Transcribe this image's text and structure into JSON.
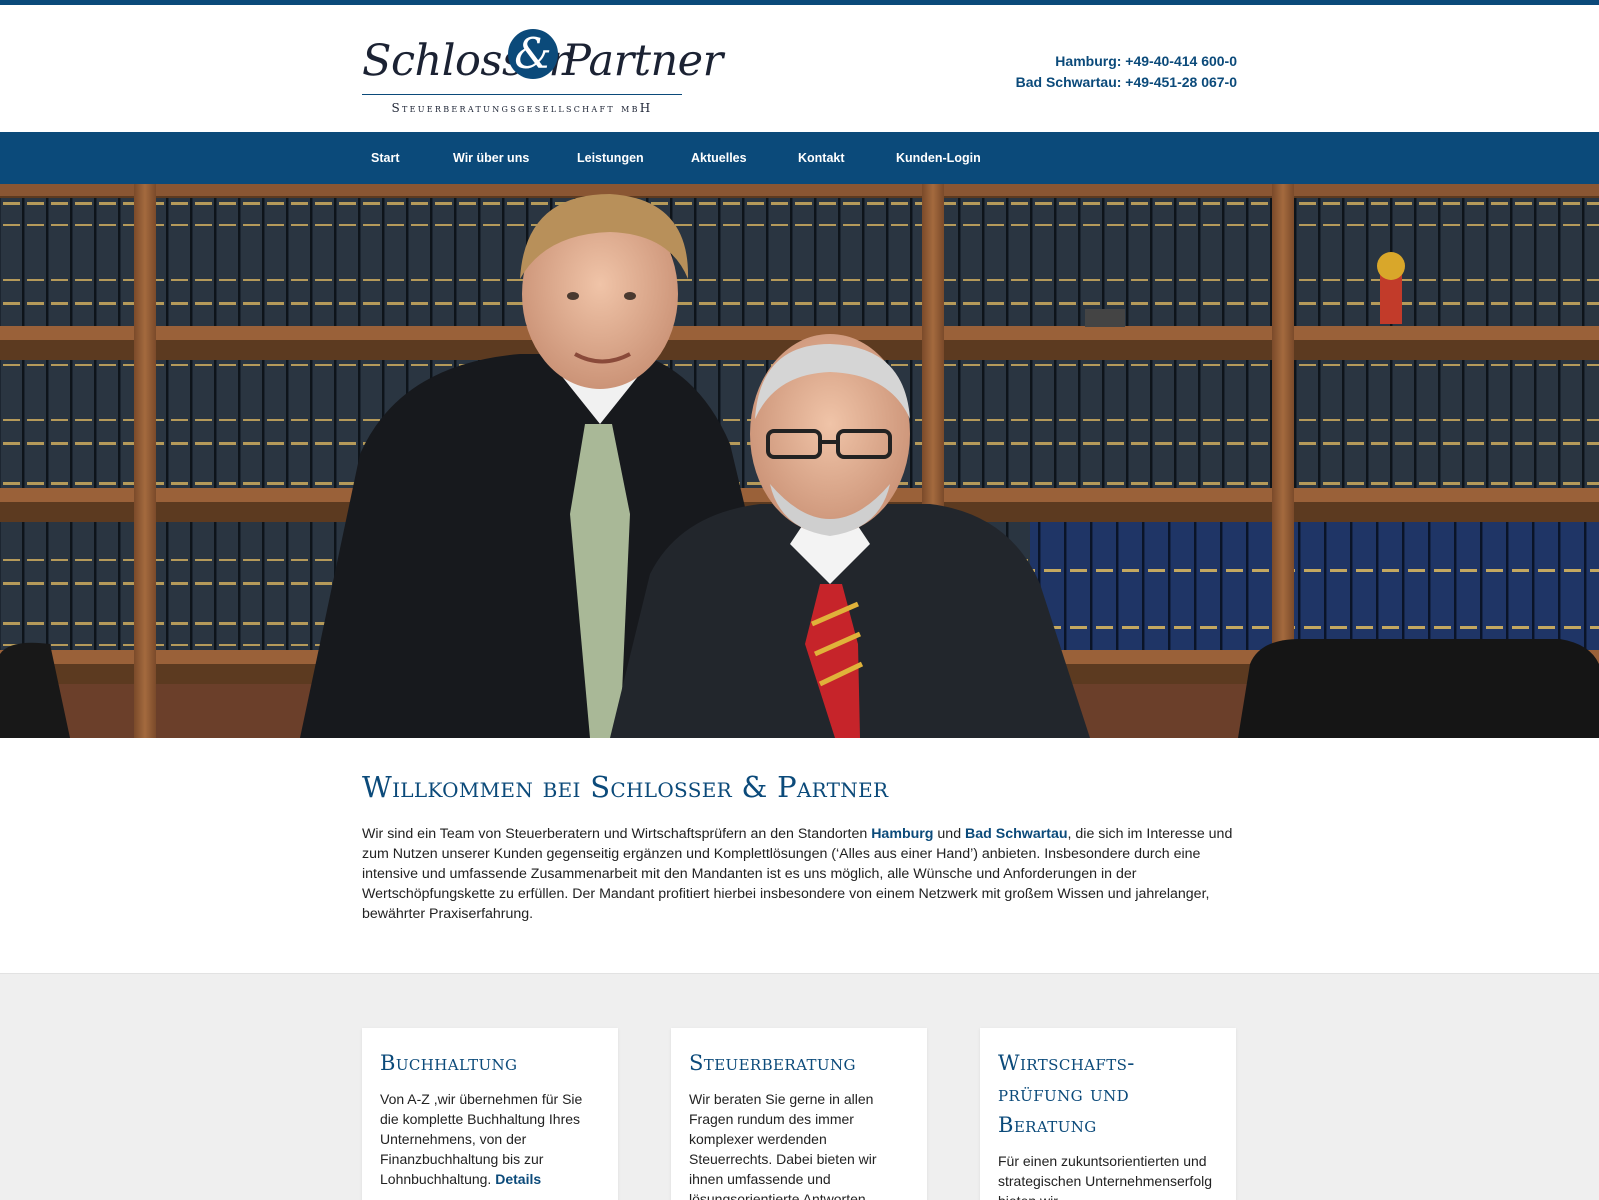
{
  "logo": {
    "name_left": "Schlosser",
    "ampersand": "&",
    "name_right": "Partner",
    "subtitle": "Steuerberatungsgesellschaft mbH"
  },
  "contact": {
    "hamburg": "Hamburg: +49-40-414 600-0",
    "bad_schwartau": "Bad Schwartau: +49-451-28 067-0"
  },
  "nav": {
    "items": [
      {
        "label": "Start"
      },
      {
        "label": "Wir über uns"
      },
      {
        "label": "Leistungen"
      },
      {
        "label": "Aktuelles"
      },
      {
        "label": "Kontakt"
      },
      {
        "label": "Kunden-Login"
      }
    ]
  },
  "colors": {
    "brand_blue": "#0b4a7a",
    "services_bg": "#efefef"
  },
  "welcome": {
    "title": "Willkommen bei Schlosser & Partner",
    "text_1": "Wir sind ein Team von Steuerberatern und Wirtschaftsprüfern an den Standorten ",
    "link_hamburg": "Hamburg",
    "text_2": " und ",
    "link_bad_schwartau": "Bad Schwartau",
    "text_3": ", die sich im Interesse und zum Nutzen unserer Kunden gegenseitig ergänzen und Komplettlösungen (‘Alles aus einer Hand’) anbieten. Insbesondere durch eine intensive und umfassende Zusammenarbeit mit den Mandanten ist es uns möglich, alle Wünsche und Anforderungen in der Wertschöpfungskette zu erfüllen. Der Mandant profitiert hierbei insbesondere von einem Netzwerk mit großem Wissen und jahrelanger, bewährter Praxiserfahrung."
  },
  "services": [
    {
      "title": "Buchhaltung",
      "text": "Von A-Z ,wir übernehmen für Sie die komplette Buchhaltung Ihres Unternehmens, von der Finanzbuchhaltung bis zur Lohnbuchhaltung. ",
      "link": "Details"
    },
    {
      "title": "Steuerberatung",
      "text": "Wir beraten Sie gerne in allen Fragen rundum des immer komplexer werdenden Steuerrechts. Dabei bieten wir ihnen umfassende und lösungsorientierte Antworten"
    },
    {
      "title_line1": "Wirtschafts-",
      "title_line2": "prüfung und",
      "title_line3": "Beratung",
      "text": "Für einen zukuntsorientierten und strategischen Unternehmenserfolg bieten wir"
    }
  ]
}
